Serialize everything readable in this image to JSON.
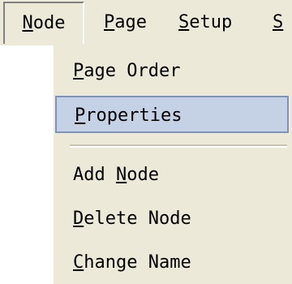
{
  "menubar": {
    "items": [
      {
        "first": "N",
        "rest": "ode"
      },
      {
        "first": "P",
        "rest": "age"
      },
      {
        "first": "S",
        "rest": "etup"
      },
      {
        "first": "S",
        "rest": ""
      }
    ]
  },
  "dropdown": {
    "items": [
      {
        "first": "P",
        "rest": "age Order"
      },
      {
        "first": "P",
        "rest": "roperties"
      },
      {
        "before": "Add ",
        "key": "N",
        "after": "ode"
      },
      {
        "first": "D",
        "rest": "elete Node"
      },
      {
        "first": "C",
        "rest": "hange Name"
      }
    ]
  },
  "colors": {
    "menu_background": "#ece9d8",
    "highlight_background": "#c5d2e6",
    "highlight_border": "#7f93b8"
  }
}
